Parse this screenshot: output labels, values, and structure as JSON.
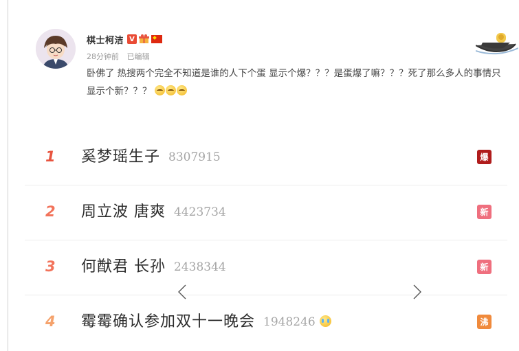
{
  "post": {
    "username": "棋士柯洁",
    "verified_badge": "V",
    "time": "28分钟前",
    "edited": "已编辑",
    "text": "卧佛了 热搜两个完全不知道是谁的人下个蛋 显示个爆？？？是蛋爆了嘛？？？死了那么多人的事情只显示个新？？？",
    "emoji_count": 3
  },
  "hot_search": {
    "items": [
      {
        "rank": "1",
        "title": "奚梦瑶生子",
        "count": "8307915",
        "tag": "爆",
        "tag_color": "#b01c1c",
        "rank_color": "#e8543f"
      },
      {
        "rank": "2",
        "title": "周立波 唐爽",
        "count": "4423734",
        "tag": "新",
        "tag_color": "#ef6f7e",
        "rank_color": "#f2735b"
      },
      {
        "rank": "3",
        "title": "何猷君 长孙",
        "count": "2438344",
        "tag": "新",
        "tag_color": "#ef6f7e",
        "rank_color": "#f2735b"
      },
      {
        "rank": "4",
        "title": "霉霉确认参加双十一晚会",
        "count": "1948246",
        "tag": "沸",
        "tag_color": "#f08a3c",
        "rank_color": "#f5a26c"
      }
    ]
  },
  "icons": {
    "chevron": "chevron-down-icon",
    "prev": "chevron-left-icon",
    "next": "chevron-right-icon"
  }
}
